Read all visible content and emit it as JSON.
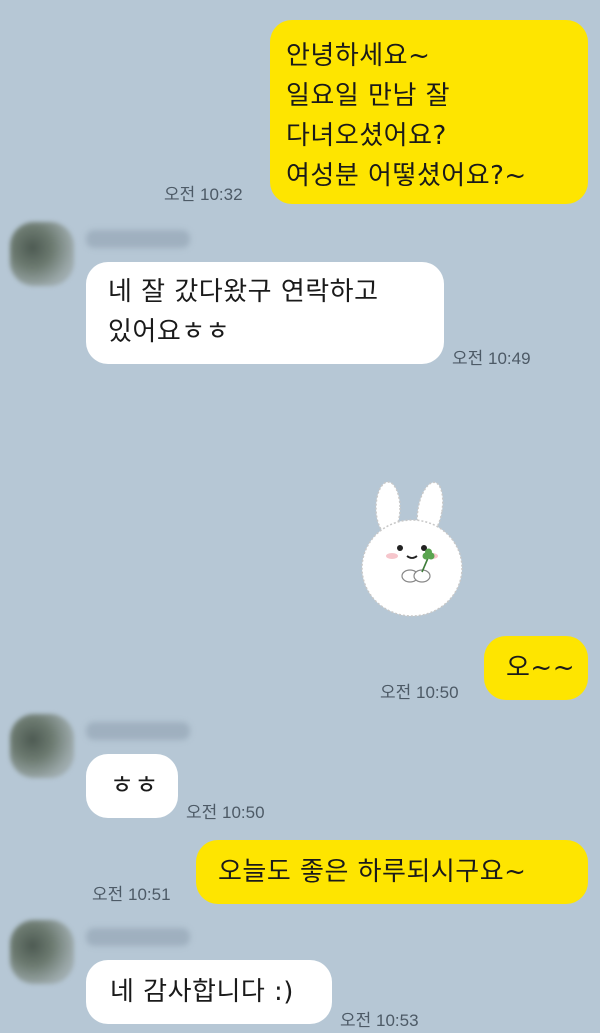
{
  "colors": {
    "background": "#b6c7d5",
    "outgoing_bubble": "#fee500",
    "incoming_bubble": "#ffffff"
  },
  "messages": [
    {
      "direction": "out",
      "text": "안녕하세요~\n일요일 만남  잘\n다녀오셨어요?\n여성분  어떻셨어요?~",
      "time": "오전 10:32"
    },
    {
      "direction": "in",
      "text": "네 잘 갔다왔구 연락하고\n있어요ㅎㅎ",
      "time": "오전 10:49"
    },
    {
      "direction": "in",
      "type": "sticker",
      "sticker": "bunny-holding-clover",
      "time": ""
    },
    {
      "direction": "out",
      "text": "오~~",
      "time": "오전 10:50"
    },
    {
      "direction": "in",
      "text": "ㅎㅎ",
      "time": "오전 10:50"
    },
    {
      "direction": "out",
      "text": "오늘도 좋은 하루되시구요~",
      "time": "오전 10:51"
    },
    {
      "direction": "in",
      "text": "네 감사합니다 :)",
      "time": "오전 10:53"
    }
  ]
}
